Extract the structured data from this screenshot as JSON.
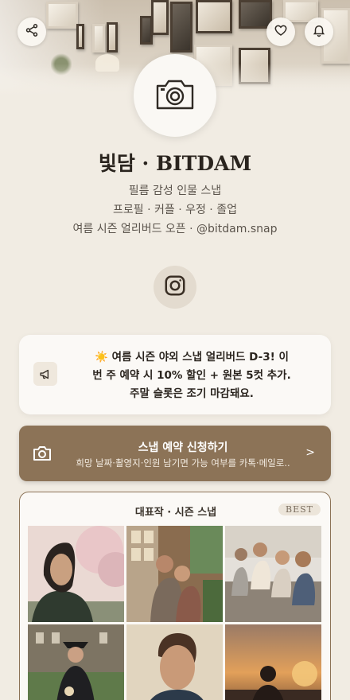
{
  "profile": {
    "name": "빛담 · BITDAM",
    "tagline": "필름 감성 인물 스냅",
    "categories": "프로필 · 커플 · 우정 · 졸업",
    "promo_line": "여름 시즌 얼리버드 오픈 · @bitdam.snap"
  },
  "header": {
    "share_icon": "share-icon",
    "like_icon": "heart-icon",
    "notify_icon": "bell-icon"
  },
  "avatar_icon": "camera-icon",
  "social": {
    "instagram_icon": "instagram-icon"
  },
  "notice": {
    "icon": "megaphone-icon",
    "line1": "☀️ 여름 시즌 야외 스냅 얼리버드 D-3! 이",
    "line2": "번 주 예약 시 10% 할인 + 원본 5컷 추가.",
    "line3": "주말 슬롯은 조기 마감돼요."
  },
  "cta": {
    "icon": "camera-icon",
    "title": "스냅 예약 신청하기",
    "subtitle": "희망 날짜·촬영지·인원 남기면 가능 여부를 카톡·메일로..",
    "chevron": ">"
  },
  "gallery": {
    "title": "대표작 · 시즌 스냅",
    "badge": "BEST",
    "photos": [
      "portrait-woman-cherry-blossom",
      "couple-balcony",
      "friends-on-sofa",
      "graduate-cap-gown",
      "portrait-man-sunlight",
      "silhouette-sunset"
    ]
  },
  "colors": {
    "background": "#f1ece3",
    "accent": "#8c7357",
    "card": "#fbf9f6"
  }
}
